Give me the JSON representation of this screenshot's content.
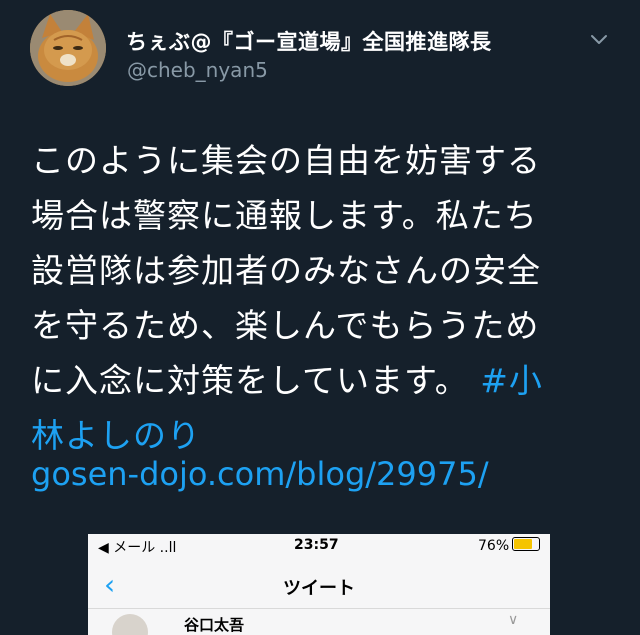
{
  "tweet": {
    "author_name": "ちぇぶ@『ゴー宣道場』全国推進隊長",
    "handle": "@cheb_nyan5",
    "text_lines": [
      "このように集会の自由を妨害する",
      "場合は警察に通報します。私たち",
      "設営隊は参加者のみなさんの安全",
      "を守るため、楽しんでもらうため",
      "に入念に対策をしています。"
    ],
    "hashtag_part1": "#小",
    "hashtag_part2": "林よしのり",
    "link": "gosen-dojo.com/blog/29975/"
  },
  "embedded": {
    "status_left": "◀ メール ..ll",
    "time": "23:57",
    "battery": "76%",
    "back": "‹",
    "title": "ツイート",
    "user_name": "谷口太吾",
    "chevron": "∨"
  },
  "colors": {
    "background": "#15202b",
    "accent": "#1da1f2",
    "secondary_text": "#8899a6"
  }
}
